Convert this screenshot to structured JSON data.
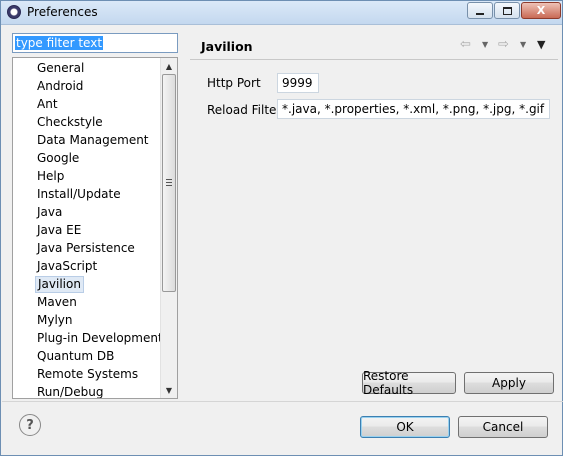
{
  "window": {
    "title": "Preferences",
    "minimize_icon": "minimize-icon",
    "maximize_icon": "maximize-icon",
    "close_glyph": "X"
  },
  "filter": {
    "text": "type filter text"
  },
  "tree": {
    "items": [
      {
        "label": "General"
      },
      {
        "label": "Android"
      },
      {
        "label": "Ant"
      },
      {
        "label": "Checkstyle"
      },
      {
        "label": "Data Management"
      },
      {
        "label": "Google"
      },
      {
        "label": "Help"
      },
      {
        "label": "Install/Update"
      },
      {
        "label": "Java"
      },
      {
        "label": "Java EE"
      },
      {
        "label": "Java Persistence"
      },
      {
        "label": "JavaScript"
      },
      {
        "label": "Javilion"
      },
      {
        "label": "Maven"
      },
      {
        "label": "Mylyn"
      },
      {
        "label": "Plug-in Development"
      },
      {
        "label": "Quantum DB"
      },
      {
        "label": "Remote Systems"
      },
      {
        "label": "Run/Debug"
      }
    ],
    "selected": "Javilion"
  },
  "page": {
    "title": "Javilion",
    "http_port_label": "Http Port",
    "http_port_value": "9999",
    "reload_filter_label": "Reload Filter",
    "reload_filter_value": "*.java, *.properties, *.xml, *.png, *.jpg, *.gif",
    "restore_defaults_label": "Restore Defaults",
    "apply_label": "Apply"
  },
  "footer": {
    "ok_label": "OK",
    "cancel_label": "Cancel",
    "help_glyph": "?"
  }
}
